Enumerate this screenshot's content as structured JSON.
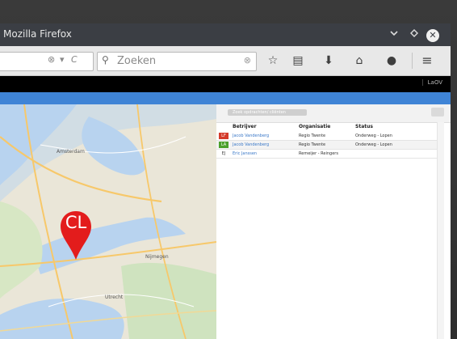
{
  "window": {
    "title": "Mozilla Firefox",
    "min_icon": "chevron-down-icon",
    "max_icon": "diamond-icon",
    "close_icon": "close-icon"
  },
  "navbar": {
    "url_reload_glyph": "C",
    "search_placeholder": "Zoeken",
    "icons": [
      "star-icon",
      "reading-list-icon",
      "download-icon",
      "home-icon",
      "chat-icon",
      "menu-icon"
    ]
  },
  "app": {
    "name": "LaOV"
  },
  "map": {
    "marker_label": "CL",
    "marker_color": "#e31c1c",
    "place_labels": [
      "Amsterdam",
      "Nijmegen",
      "Utrecht"
    ]
  },
  "panel": {
    "search_pill_text": "Zoek opdrachten/ cliënten",
    "columns": [
      "Betrijver",
      "Organisatie",
      "Status"
    ],
    "rows": [
      {
        "badge": "LF",
        "badge_color": "#d43a2a",
        "name": "Jacob Vandenberg",
        "org": "Regio Twente",
        "status": "Onderweg - Lopen"
      },
      {
        "badge": "LA",
        "badge_color": "#4aa02c",
        "name": "Jacob Vandenberg",
        "org": "Regio Twente",
        "status": "Onderweg - Lopen"
      },
      {
        "badge": "EJ",
        "badge_color": "#ffffff",
        "name": "Eric Janssen",
        "org": "Remeijer - Reingers",
        "status": ""
      }
    ]
  }
}
